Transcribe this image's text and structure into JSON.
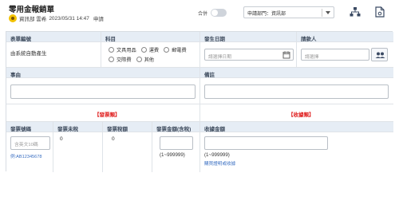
{
  "header": {
    "title": "零用金報銷單",
    "dept_user": "資訊部 雲希",
    "datetime": "2023/05/31 14:47",
    "status": "申請",
    "merge_label": "合併",
    "dept_select": "申請部門：資訊部"
  },
  "form": {
    "row1": {
      "form_no_label": "表單編號",
      "form_no_value": "由系統自動產生",
      "subject_label": "科目",
      "subject_options": [
        "文具用品",
        "運費",
        "郵電費",
        "交際費",
        "其他"
      ],
      "date_label": "發生日期",
      "date_placeholder": "請選擇日期",
      "payee_label": "請款人",
      "payee_placeholder": "請選擇"
    },
    "row2": {
      "reason_label": "事由",
      "note_label": "備註"
    },
    "sections": {
      "invoice": "【發票類】",
      "receipt": "【收據類】"
    },
    "invoice": {
      "col_no": "發票號碼",
      "col_untaxed": "發票未稅",
      "col_tax": "發票稅額",
      "col_amount": "發票金額(含稅)",
      "no_placeholder": "含英文10碼",
      "no_example": "例:AB12345678",
      "untaxed_value": "0",
      "tax_value": "0",
      "amount_range": "(1~999999)"
    },
    "receipt": {
      "col_amount": "收據金額",
      "amount_range": "(1~999999)",
      "link": "購買證明或收據"
    }
  },
  "colors": {
    "header_bg": "#e6edf5",
    "accent_red": "#e02020",
    "link_blue": "#3a6fc2",
    "avatar": "#f2c200"
  },
  "icons": [
    "org-chart-icon",
    "document-icon",
    "calendar-icon",
    "people-icon",
    "avatar-icon"
  ]
}
